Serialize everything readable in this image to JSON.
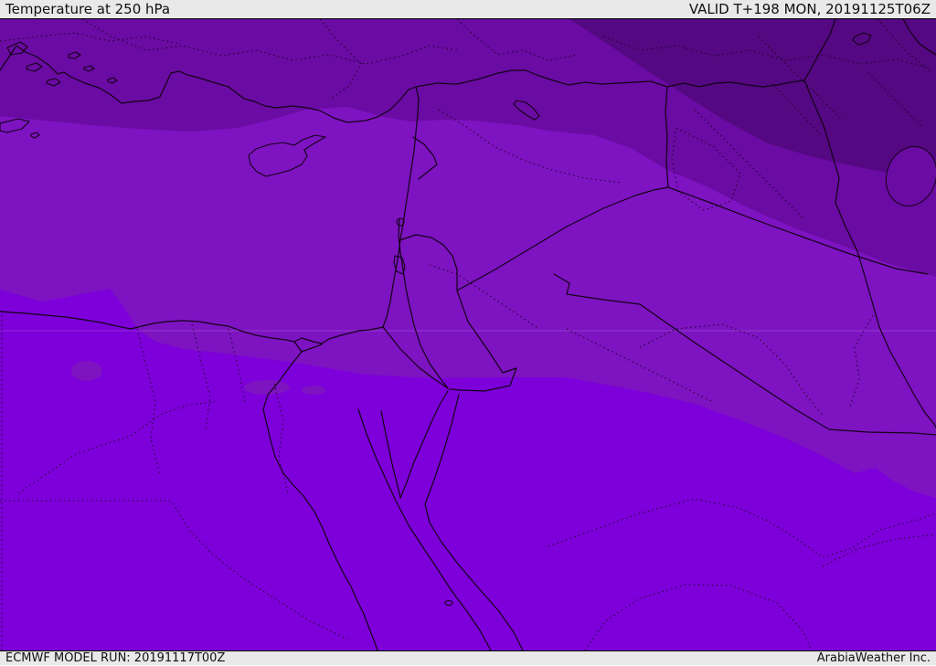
{
  "header": {
    "title": "Temperature at 250 hPa",
    "valid_label": "VALID T+198 MON, 20191125T06Z"
  },
  "footer": {
    "model_run": "ECMWF MODEL RUN: 20191117T00Z",
    "brand": "ArabiaWeather Inc."
  },
  "map": {
    "type": "temperature-shading-map",
    "region": "Eastern Mediterranean / Middle East (Turkey, Cyprus, Levant, Egypt, Iraq, Saudi Arabia)",
    "bands": [
      {
        "name": "south-warmest-violet",
        "color": "#7d00da"
      },
      {
        "name": "mid-band-purple",
        "color": "#7d13c1"
      },
      {
        "name": "north-dark-purple",
        "color": "#6a0ba3"
      },
      {
        "name": "northeast-coldest-purple",
        "color": "#540881"
      }
    ],
    "line_colors": {
      "coastline_border": "#140016",
      "admin_dotted": "#1a0322",
      "bar_background": "#e9e9e9",
      "bar_text": "#101010"
    }
  }
}
